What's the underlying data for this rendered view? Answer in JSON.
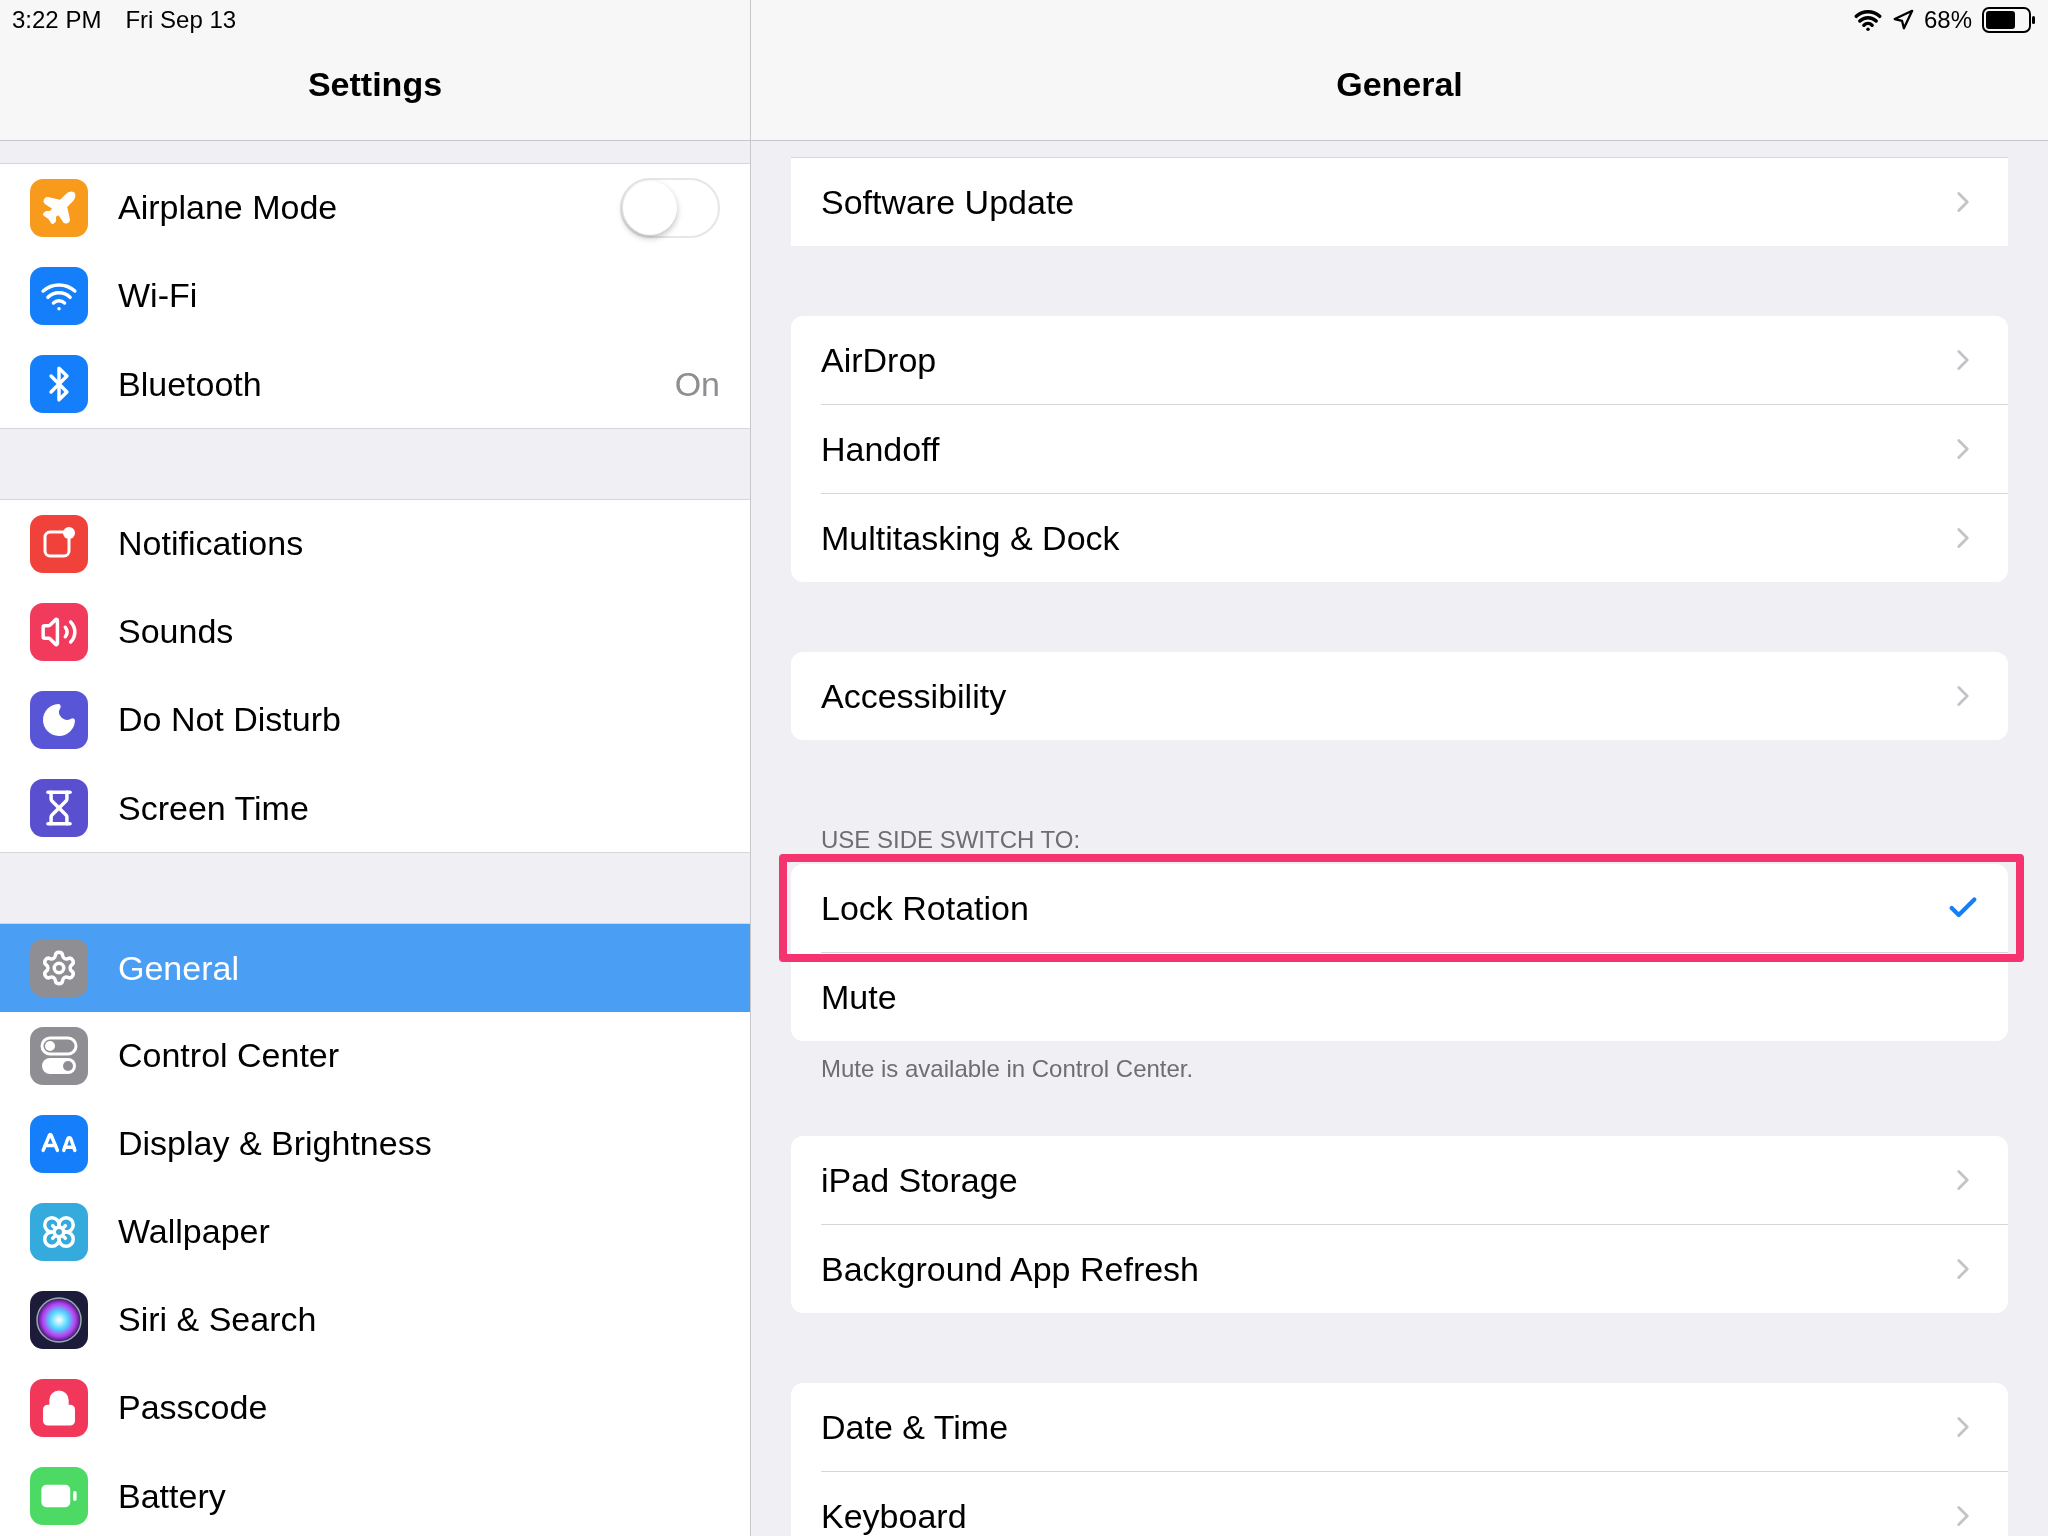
{
  "status_bar": {
    "time": "3:22 PM",
    "date": "Fri Sep 13",
    "battery": "68%"
  },
  "sidebar": {
    "title": "Settings",
    "groups": [
      [
        {
          "label": "Airplane Mode",
          "kind": "toggle",
          "on": false,
          "color": "#f89a1c",
          "selected": false
        },
        {
          "label": "Wi-Fi",
          "kind": "plain",
          "color": "#157efb",
          "selected": false
        },
        {
          "label": "Bluetooth",
          "kind": "value",
          "value": "On",
          "color": "#157efb",
          "selected": false
        }
      ],
      [
        {
          "label": "Notifications",
          "kind": "plain",
          "color": "#f0413a",
          "selected": false
        },
        {
          "label": "Sounds",
          "kind": "plain",
          "color": "#f23a5c",
          "selected": false
        },
        {
          "label": "Do Not Disturb",
          "kind": "plain",
          "color": "#5856d6",
          "selected": false
        },
        {
          "label": "Screen Time",
          "kind": "plain",
          "color": "#5a4fcf",
          "selected": false
        }
      ],
      [
        {
          "label": "General",
          "kind": "plain",
          "color": "#8e8e93",
          "selected": true
        },
        {
          "label": "Control Center",
          "kind": "plain",
          "color": "#8e8e93",
          "selected": false
        },
        {
          "label": "Display & Brightness",
          "kind": "plain",
          "color": "#157efb",
          "selected": false
        },
        {
          "label": "Wallpaper",
          "kind": "plain",
          "color": "#35aadc",
          "selected": false
        },
        {
          "label": "Siri & Search",
          "kind": "plain",
          "color": "#1c1c3a",
          "selected": false
        },
        {
          "label": "Passcode",
          "kind": "plain",
          "color": "#f2385a",
          "selected": false
        },
        {
          "label": "Battery",
          "kind": "plain",
          "color": "#4cd964",
          "selected": false
        }
      ]
    ]
  },
  "detail": {
    "title": "General",
    "groups": [
      {
        "rows": [
          {
            "label": "Software Update",
            "kind": "link"
          }
        ]
      },
      {
        "rows": [
          {
            "label": "AirDrop",
            "kind": "link"
          },
          {
            "label": "Handoff",
            "kind": "link"
          },
          {
            "label": "Multitasking & Dock",
            "kind": "link"
          }
        ]
      },
      {
        "rows": [
          {
            "label": "Accessibility",
            "kind": "link"
          }
        ]
      },
      {
        "header": "USE SIDE SWITCH TO:",
        "footer": "Mute is available in Control Center.",
        "rows": [
          {
            "label": "Lock Rotation",
            "kind": "option",
            "selected": true,
            "highlighted": true
          },
          {
            "label": "Mute",
            "kind": "option",
            "selected": false,
            "highlighted": false
          }
        ]
      },
      {
        "rows": [
          {
            "label": "iPad Storage",
            "kind": "link"
          },
          {
            "label": "Background App Refresh",
            "kind": "link"
          }
        ]
      },
      {
        "rows": [
          {
            "label": "Date & Time",
            "kind": "link"
          },
          {
            "label": "Keyboard",
            "kind": "link"
          }
        ]
      }
    ]
  }
}
